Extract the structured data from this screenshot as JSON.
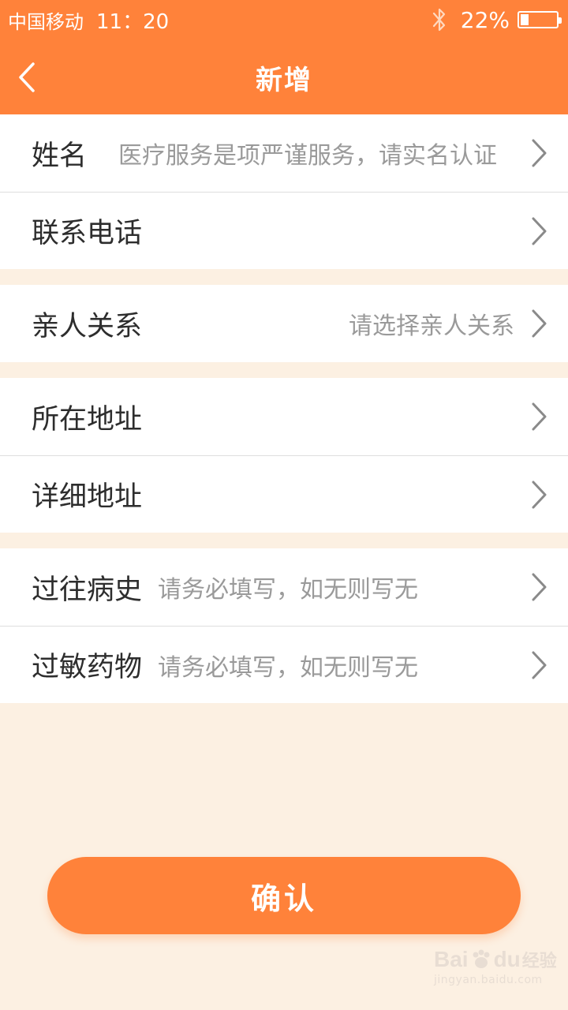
{
  "status_bar": {
    "carrier": "中国移动",
    "time": "11：20",
    "battery_percent": "22%",
    "battery_level": 0.22,
    "bluetooth_icon": "bluetooth-icon"
  },
  "nav": {
    "title": "新增",
    "back_icon": "chevron-left-icon"
  },
  "form": {
    "name": {
      "label": "姓名",
      "placeholder": "医疗服务是项严谨服务，请实名认证"
    },
    "phone": {
      "label": "联系电话"
    },
    "relation": {
      "label": "亲人关系",
      "placeholder": "请选择亲人关系"
    },
    "address": {
      "label": "所在地址"
    },
    "detail_address": {
      "label": "详细地址"
    },
    "medical_history": {
      "label": "过往病史",
      "placeholder": "请务必填写，如无则写无"
    },
    "allergy_drugs": {
      "label": "过敏药物",
      "placeholder": "请务必填写，如无则写无"
    }
  },
  "confirm_label": "确认",
  "watermark": {
    "main": "Bai",
    "main_tail": "du",
    "suffix": "经验",
    "sub": "jingyan.baidu.com"
  },
  "colors": {
    "accent": "#ff823a",
    "background": "#fcf0e2",
    "label": "#2d2d2d",
    "placeholder": "#9a9a9a"
  }
}
